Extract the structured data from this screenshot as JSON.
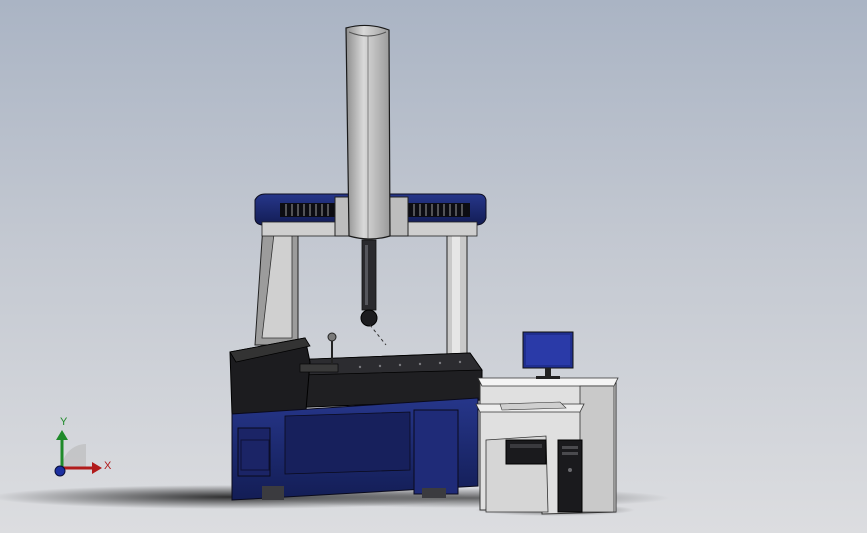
{
  "viewport": {
    "scene": "coordinate-measuring-machine-assembly",
    "colors": {
      "background_top": "#aab4c4",
      "background_bottom": "#dcdde0",
      "machine_blue": "#1b2a6e",
      "machine_black": "#1c1c1f",
      "machine_grey": "#b7b7b7",
      "table_light": "#e6e6e6",
      "monitor_blue": "#1f2e8f"
    }
  },
  "triad": {
    "y_label": "Y",
    "x_label": "X",
    "colors": {
      "x": "#b11b1b",
      "y": "#1f8a2a",
      "z": "#1c2fa0"
    }
  }
}
